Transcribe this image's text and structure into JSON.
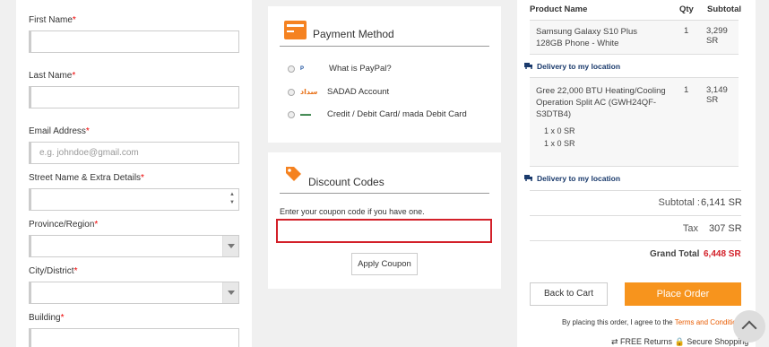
{
  "form": {
    "first_name": {
      "label": "First Name",
      "required": "*"
    },
    "last_name": {
      "label": "Last Name",
      "required": "*"
    },
    "email": {
      "label": "Email Address",
      "required": "*",
      "placeholder": "e.g. johndoe@gmail.com"
    },
    "street": {
      "label": "Street Name & Extra Details",
      "required": "*"
    },
    "province": {
      "label": "Province/Region",
      "required": "*"
    },
    "city": {
      "label": "City/District",
      "required": "*"
    },
    "building": {
      "label": "Building",
      "required": "*"
    }
  },
  "payment": {
    "title": "Payment Method",
    "options": [
      {
        "logo": "PayPal",
        "label": "What is PayPal?"
      },
      {
        "logo": "سداد",
        "label": "SADAD Account"
      },
      {
        "logo": "CREDIT mada",
        "label": "Credit / Debit Card/ mada Debit Card"
      }
    ]
  },
  "discount": {
    "title": "Discount Codes",
    "hint": "Enter your coupon code if you have one.",
    "apply_label": "Apply Coupon"
  },
  "summary": {
    "headers": {
      "product": "Product Name",
      "qty": "Qty",
      "subtotal": "Subtotal"
    },
    "items": [
      {
        "name": "Samsung Galaxy S10 Plus 128GB Phone - White",
        "qty": "1",
        "subtotal": "3,299 SR",
        "extras": [],
        "delivery": "Delivery to my location"
      },
      {
        "name": "Gree 22,000 BTU Heating/Cooling Operation Split AC (GWH24QF-S3DTB4)",
        "qty": "1",
        "subtotal": "3,149 SR",
        "extras": [
          "1 x 0 SR",
          "1 x 0 SR"
        ],
        "delivery": "Delivery to my location"
      }
    ],
    "subtotal_label": "Subtotal :",
    "subtotal_value": "6,141 SR",
    "tax_label": "Tax",
    "tax_value": "307 SR",
    "grand_label": "Grand Total",
    "grand_value": "6,448 SR",
    "back_label": "Back to Cart",
    "order_label": "Place Order",
    "agree_text": "By placing this order, I agree to the",
    "terms_link": "Terms and Conditions",
    "badges": "⇄ FREE Returns  🔒 Secure Shopping"
  },
  "colors": {
    "accent": "#f7941d",
    "error_border": "#d32029",
    "link": "#e85b00"
  }
}
